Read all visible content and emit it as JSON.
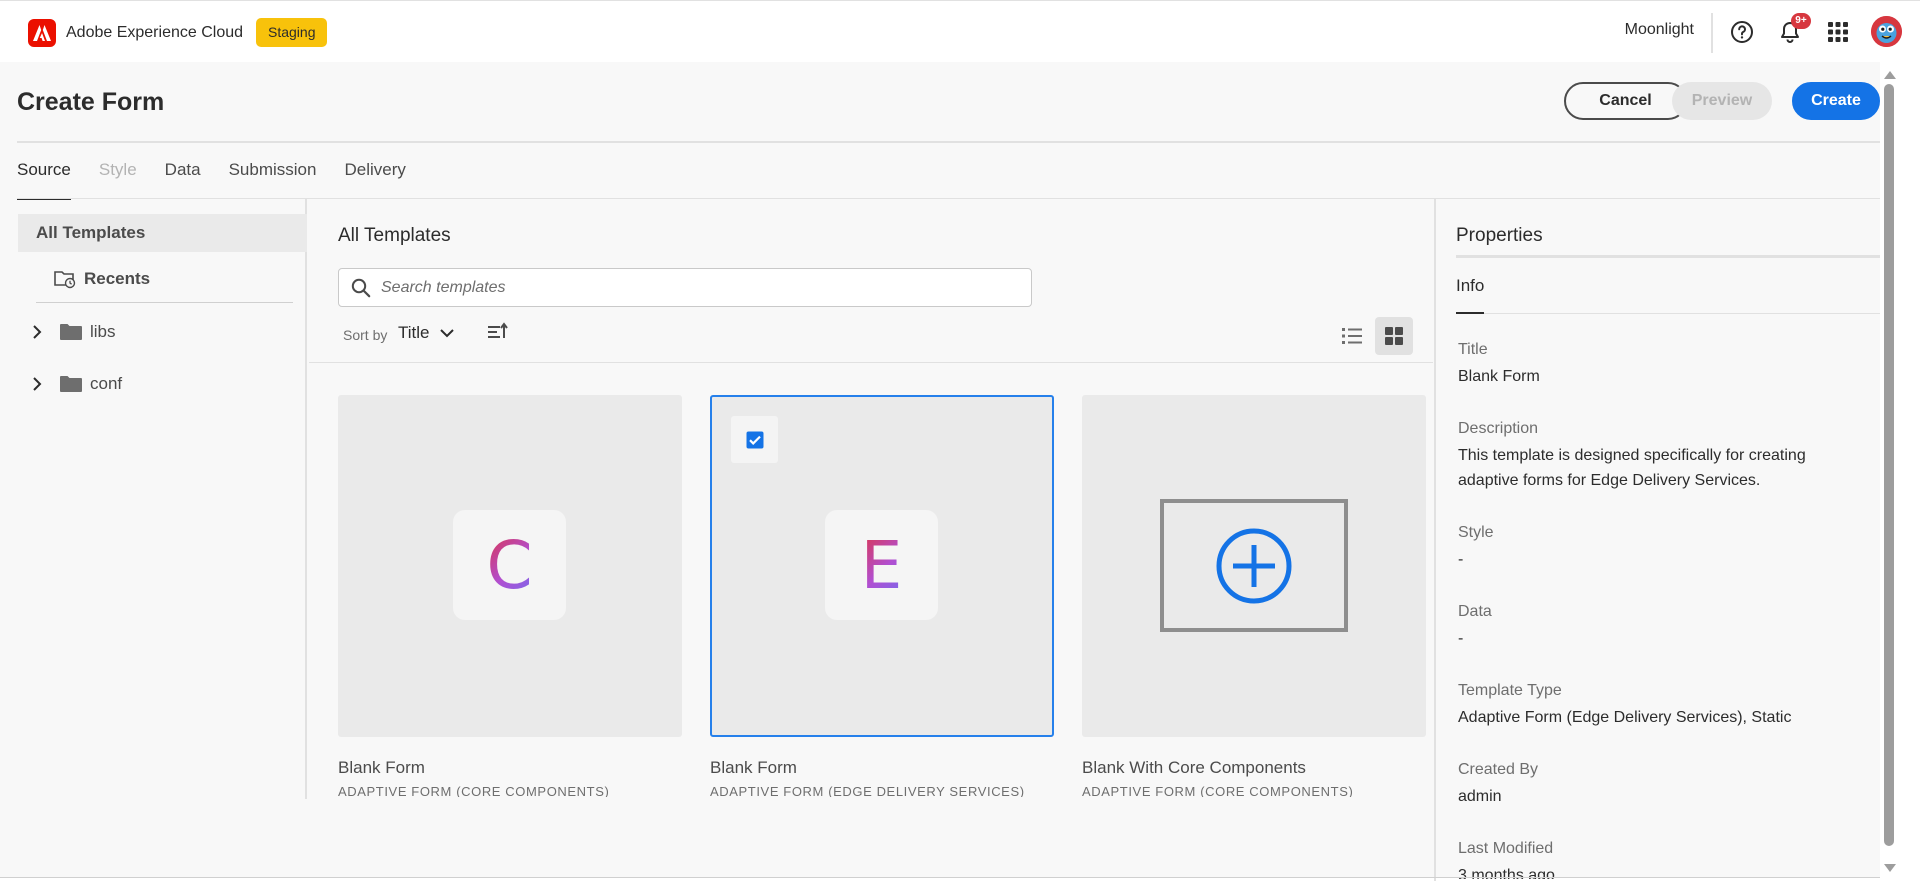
{
  "topbar": {
    "brand_name": "Adobe Experience Cloud",
    "environment_badge": "Staging",
    "org_name": "Moonlight",
    "notification_count": "9+"
  },
  "header": {
    "title": "Create Form",
    "cancel_label": "Cancel",
    "preview_label": "Preview",
    "create_label": "Create"
  },
  "tabs": [
    {
      "label": "Source",
      "state": "selected"
    },
    {
      "label": "Style",
      "state": "disabled"
    },
    {
      "label": "Data",
      "state": "enabled"
    },
    {
      "label": "Submission",
      "state": "enabled"
    },
    {
      "label": "Delivery",
      "state": "enabled"
    }
  ],
  "tree": {
    "all_templates": "All Templates",
    "recents": "Recents",
    "nodes": [
      {
        "label": "libs"
      },
      {
        "label": "conf"
      }
    ]
  },
  "templates": {
    "title": "All Templates",
    "search_placeholder": "Search templates",
    "sort_label": "Sort by",
    "sort_value": "Title",
    "cards": [
      {
        "name": "Blank Form",
        "type": "ADAPTIVE FORM (CORE COMPONENTS)",
        "thumb": "C",
        "selected": false
      },
      {
        "name": "Blank Form",
        "type": "ADAPTIVE FORM (EDGE DELIVERY SERVICES)",
        "thumb": "E",
        "selected": true
      },
      {
        "name": "Blank With Core Components",
        "type": "ADAPTIVE FORM (CORE COMPONENTS)",
        "thumb": "plus-icon",
        "selected": false
      }
    ]
  },
  "properties": {
    "title": "Properties",
    "tab": "Info",
    "fields": [
      {
        "label": "Title",
        "value": "Blank Form"
      },
      {
        "label": "Description",
        "value": "This template is designed specifically for creating adaptive forms for Edge Delivery Services."
      },
      {
        "label": "Style",
        "value": "-"
      },
      {
        "label": "Data",
        "value": "-"
      },
      {
        "label": "Template Type",
        "value": "Adaptive Form (Edge Delivery Services), Static"
      },
      {
        "label": "Created By",
        "value": "admin"
      },
      {
        "label": "Last Modified",
        "value": "3 months ago"
      }
    ]
  },
  "colors": {
    "accent": "#1473e6",
    "adobe_red": "#eb1000",
    "staging_yellow": "#f8c20b"
  }
}
